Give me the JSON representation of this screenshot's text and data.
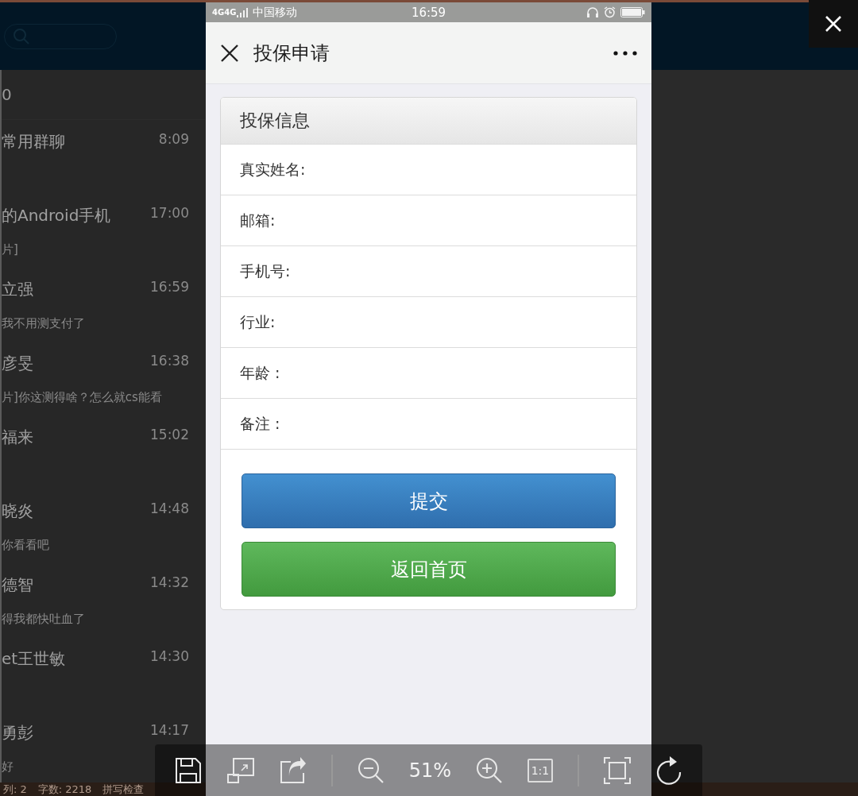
{
  "background_app": {
    "list_heading": "0",
    "chats": [
      {
        "name": "常用群聊",
        "time": "8:09"
      },
      {
        "name": "的Android手机",
        "time": "17:00",
        "preview": "片]"
      },
      {
        "name": "立强",
        "time": "16:59",
        "preview": "我不用测支付了"
      },
      {
        "name": "彦旻",
        "time": "16:38",
        "preview": "片]你这测得啥？怎么就cs能看"
      },
      {
        "name": "福来",
        "time": "15:02"
      },
      {
        "name": "晓炎",
        "time": "14:48",
        "preview": "你看看吧"
      },
      {
        "name": "德智",
        "time": "14:32",
        "preview": "得我都快吐血了"
      },
      {
        "name": "et王世敏",
        "time": "14:30"
      },
      {
        "name": "勇彭",
        "time": "14:17",
        "preview": "好"
      }
    ],
    "status_bar": [
      "列: 2",
      "字数: 2218",
      "拼写检查"
    ]
  },
  "phone": {
    "status_bar": {
      "networks": [
        "4G",
        "4G"
      ],
      "carrier": "中国移动",
      "time": "16:59"
    },
    "nav": {
      "title": "投保申请"
    },
    "card": {
      "title": "投保信息",
      "fields": [
        {
          "label": "真实姓名:"
        },
        {
          "label": "邮箱:"
        },
        {
          "label": "手机号:"
        },
        {
          "label": "行业:"
        },
        {
          "label": "年龄 :"
        },
        {
          "label": "备注 :"
        }
      ],
      "buttons": [
        {
          "label": "提交",
          "kind": "primary"
        },
        {
          "label": "返回首页",
          "kind": "success"
        }
      ]
    }
  },
  "viewer": {
    "toolbar": {
      "zoom": "51%",
      "actual_size": "1:1"
    }
  }
}
